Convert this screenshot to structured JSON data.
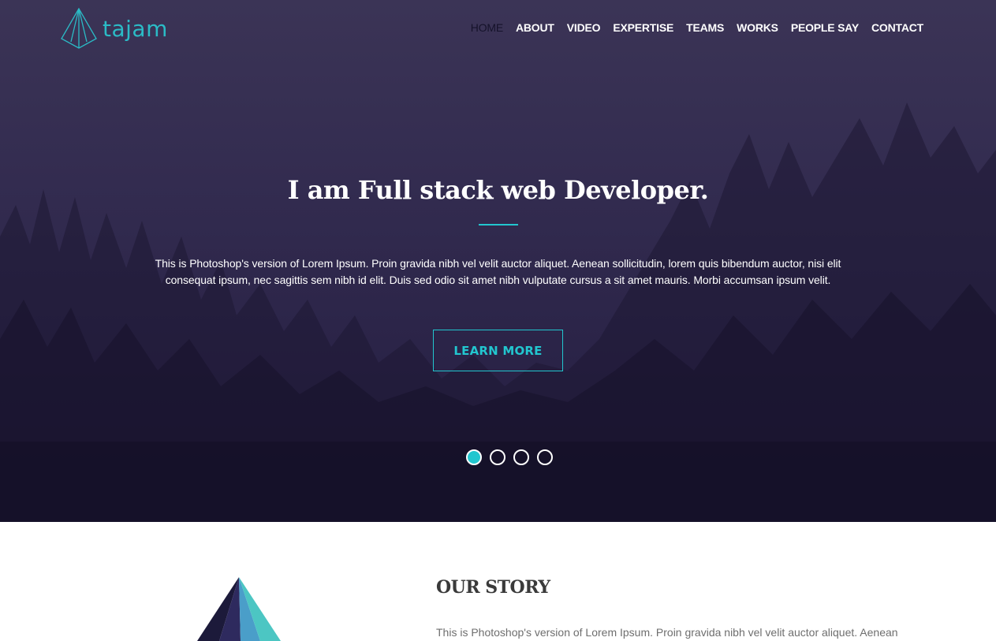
{
  "brand": {
    "name": "tajam",
    "accent": "#22c6cf"
  },
  "nav": {
    "items": [
      {
        "label": "HOME",
        "active": true
      },
      {
        "label": "ABOUT"
      },
      {
        "label": "VIDEO"
      },
      {
        "label": "EXPERTISE"
      },
      {
        "label": "TEAMS"
      },
      {
        "label": "WORKS"
      },
      {
        "label": "PEOPLE SAY"
      },
      {
        "label": "CONTACT"
      }
    ]
  },
  "hero": {
    "title": "I am Full stack web Developer.",
    "text": "This is Photoshop's version of Lorem Ipsum. Proin gravida nibh vel velit auctor aliquet. Aenean sollicitudin, lorem quis bibendum auctor, nisi elit consequat ipsum, nec sagittis sem nibh id elit. Duis sed odio sit amet nibh vulputate cursus a sit amet mauris. Morbi accumsan ipsum velit.",
    "button_label": "LEARN MORE",
    "slides": {
      "count": 4,
      "active": 1
    }
  },
  "story": {
    "title": "OUR STORY",
    "text": "This is Photoshop's version of Lorem Ipsum. Proin gravida nibh vel velit auctor aliquet. Aenean"
  }
}
